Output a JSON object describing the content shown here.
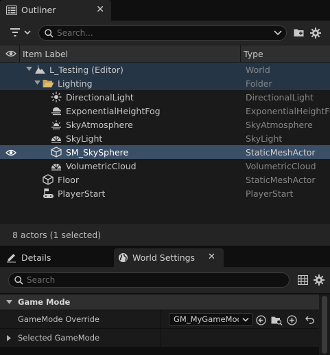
{
  "outliner": {
    "title": "Outliner",
    "close_glyph": "✕",
    "search_placeholder": "Search...",
    "columns": {
      "label": "Item Label",
      "type": "Type"
    },
    "rows": [
      {
        "label": "L_Testing (Editor)",
        "type": "World",
        "icon": "level-icon",
        "expanded": true
      },
      {
        "label": "Lighting",
        "type": "Folder",
        "icon": "folder-icon",
        "expanded": true
      },
      {
        "label": "DirectionalLight",
        "type": "DirectionalLight",
        "icon": "directional-light-icon"
      },
      {
        "label": "ExponentialHeightFog",
        "type": "ExponentialHeightFog",
        "icon": "height-fog-icon"
      },
      {
        "label": "SkyAtmosphere",
        "type": "SkyAtmosphere",
        "icon": "sky-atmosphere-icon"
      },
      {
        "label": "SkyLight",
        "type": "SkyLight",
        "icon": "sky-light-icon"
      },
      {
        "label": "SM_SkySphere",
        "type": "StaticMeshActor",
        "icon": "static-mesh-icon",
        "selected": true
      },
      {
        "label": "VolumetricCloud",
        "type": "VolumetricCloud",
        "icon": "volumetric-cloud-icon"
      },
      {
        "label": "Floor",
        "type": "StaticMeshActor",
        "icon": "static-mesh-icon"
      },
      {
        "label": "PlayerStart",
        "type": "PlayerStart",
        "icon": "player-start-icon"
      }
    ],
    "status": "8 actors (1 selected)"
  },
  "details_tabs": [
    {
      "label": "Details",
      "icon": "pencil-icon"
    },
    {
      "label": "World Settings",
      "icon": "globe-icon",
      "active": true,
      "close_glyph": "✕"
    }
  ],
  "details": {
    "search_placeholder": "Search",
    "section": "Game Mode",
    "properties": [
      {
        "label": "GameMode Override",
        "value": "GM_MyGameMode"
      },
      {
        "label": "Selected GameMode",
        "value": ""
      }
    ]
  },
  "colors": {
    "selection": "#3a4e66",
    "highlight": "#263546",
    "panel": "#242424",
    "background": "#1a1a1a"
  }
}
